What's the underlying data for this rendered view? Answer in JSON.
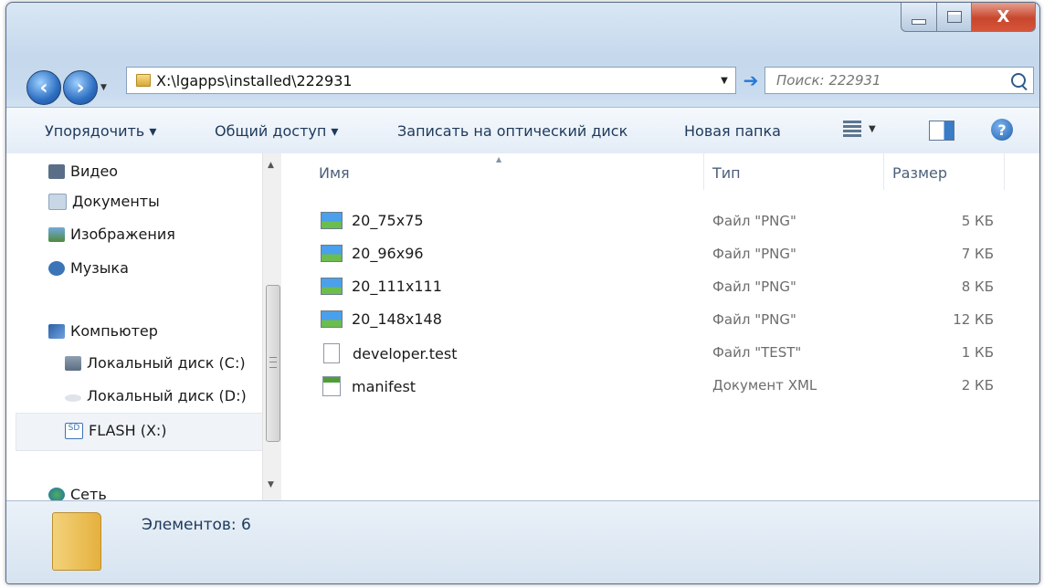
{
  "window": {
    "close_label": "X"
  },
  "nav": {
    "address": "X:\\lgapps\\installed\\222931",
    "search_placeholder": "Поиск: 222931"
  },
  "toolbar": {
    "organize": "Упорядочить ▾",
    "share": "Общий доступ ▾",
    "burn": "Записать на оптический диск",
    "new_folder": "Новая папка"
  },
  "sidebar": {
    "items": [
      {
        "label": "Видео"
      },
      {
        "label": "Документы"
      },
      {
        "label": "Изображения"
      },
      {
        "label": "Музыка"
      },
      {
        "label": "Компьютер"
      },
      {
        "label": "Локальный диск (C:)"
      },
      {
        "label": "Локальный диск (D:)"
      },
      {
        "label": "FLASH (X:)",
        "selected": true
      },
      {
        "label": "Сеть"
      }
    ]
  },
  "columns": {
    "name": "Имя",
    "type": "Тип",
    "size": "Размер"
  },
  "files": [
    {
      "name": "20_75x75",
      "type": "Файл \"PNG\"",
      "size": "5 КБ",
      "icon": "png-image-icon"
    },
    {
      "name": "20_96x96",
      "type": "Файл \"PNG\"",
      "size": "7 КБ",
      "icon": "png-image-icon"
    },
    {
      "name": "20_111x111",
      "type": "Файл \"PNG\"",
      "size": "8 КБ",
      "icon": "png-image-icon"
    },
    {
      "name": "20_148x148",
      "type": "Файл \"PNG\"",
      "size": "12 КБ",
      "icon": "png-image-icon"
    },
    {
      "name": "developer.test",
      "type": "Файл \"TEST\"",
      "size": "1 КБ",
      "icon": "blank-file-icon"
    },
    {
      "name": "manifest",
      "type": "Документ XML",
      "size": "2 КБ",
      "icon": "xml-file-icon"
    }
  ],
  "status": {
    "count_text": "Элементов: 6"
  }
}
